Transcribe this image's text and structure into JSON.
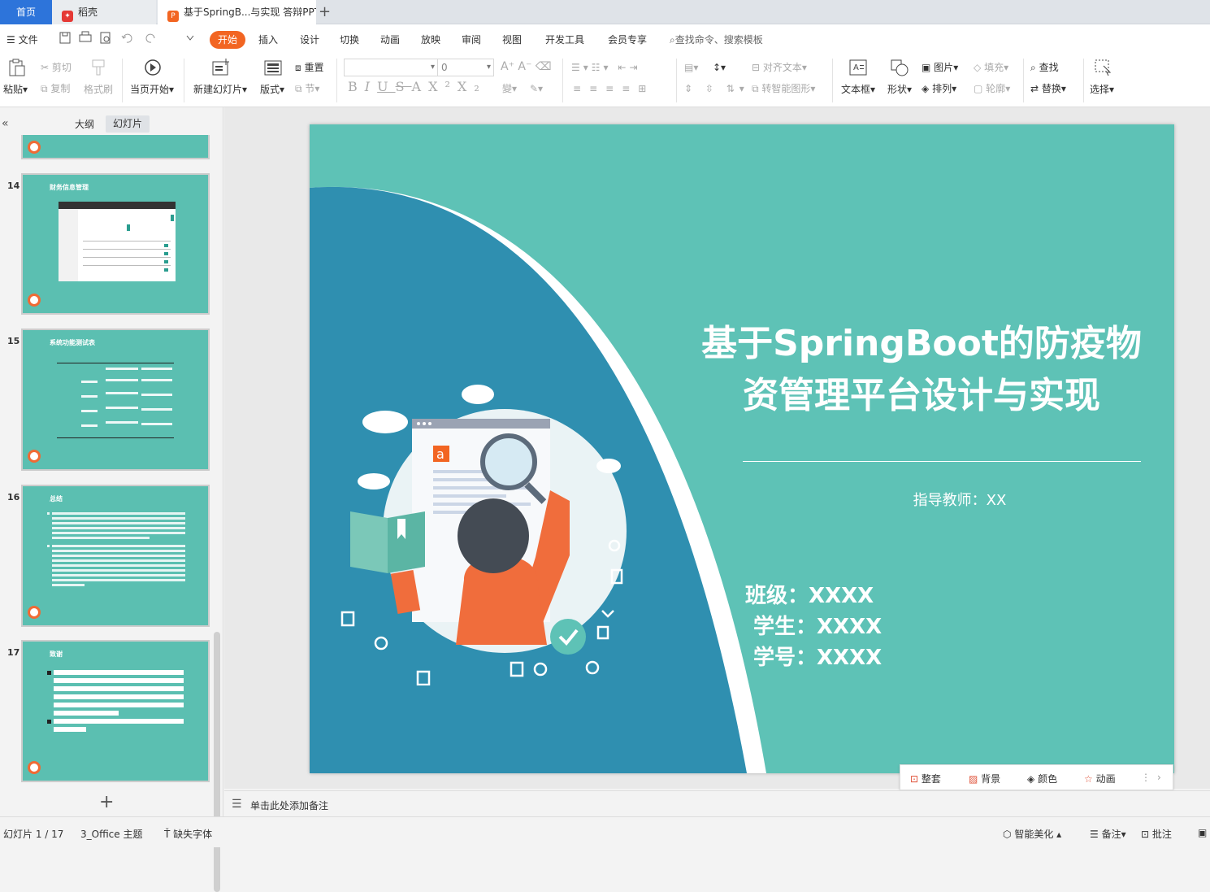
{
  "tabs": {
    "home": "首页",
    "daoke": "稻壳",
    "doc": "基于SpringB...与实现 答辩PPT",
    "plus": "+"
  },
  "menu": {
    "file": "文件",
    "start": "开始",
    "items": [
      "插入",
      "设计",
      "切换",
      "动画",
      "放映",
      "审阅",
      "视图",
      "开发工具",
      "会员专享"
    ],
    "search": "查找命令、搜索模板"
  },
  "ribbon": {
    "paste": "粘贴",
    "cut": "剪切",
    "copy": "复制",
    "format_painter": "格式刷",
    "from_start": "当页开始",
    "new_slide": "新建幻灯片",
    "layout": "版式",
    "reset": "重置",
    "section": "节",
    "font_size": "0",
    "align_text": "对齐文本",
    "smart_shape": "转智能图形",
    "textbox": "文本框",
    "shape": "形状",
    "picture": "图片",
    "arrange": "排列",
    "fill": "填充",
    "outline": "轮廓",
    "find": "查找",
    "replace": "替换",
    "select": "选择"
  },
  "panel": {
    "outline": "大纲",
    "slides": "幻灯片",
    "add": "+"
  },
  "thumbnails": [
    {
      "num": "14",
      "title": "财务信息管理"
    },
    {
      "num": "15",
      "title": "系统功能测试表"
    },
    {
      "num": "16",
      "title": "总结"
    },
    {
      "num": "17",
      "title": "致谢"
    }
  ],
  "slide": {
    "title_line1": "基于SpringBoot的防疫物",
    "title_line2": "资管理平台设计与实现",
    "advisor": "指导教师：XX",
    "class": "班级：XXXX",
    "student": "学生：XXXX",
    "student_id": "学号：XXXX",
    "illustration_letter": "a",
    "colors": {
      "bg": "#5ec2b6",
      "arc": "#2f8fb0",
      "accent": "#f26522"
    }
  },
  "floatbar": {
    "set": "整套",
    "background": "背景",
    "color": "颜色",
    "animation": "动画"
  },
  "notes": "单击此处添加备注",
  "status": {
    "slide_index": "幻灯片 1 / 17",
    "theme": "3_Office 主题",
    "missing_font": "缺失字体",
    "beautify": "智能美化",
    "notes": "备注",
    "comment": "批注"
  }
}
